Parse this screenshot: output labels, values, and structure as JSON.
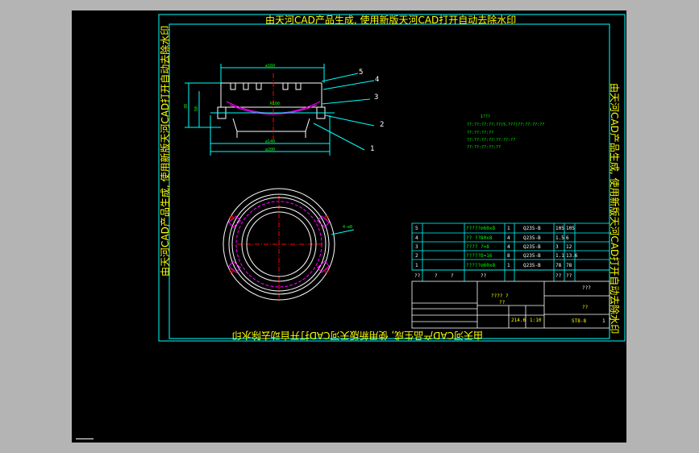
{
  "watermark": "由天河CAD产品生成, 使用新版天河CAD打开自动去除水印",
  "balloons": [
    "5",
    "4",
    "3",
    "2",
    "1"
  ],
  "tech_notes": [
    "1???",
    "??:??:??:??:??(5.???)??:??:??:??",
    "??:??:??:??",
    "??:??:??:??:??:??:??",
    "??:??:??:??:??"
  ],
  "dims": {
    "top": "∅160",
    "bottom": "∅200",
    "inner": "∅140",
    "height": "30",
    "left1": "50",
    "note": "4-∅8",
    "inner_label": "R100"
  },
  "parts": [
    {
      "no": "5",
      "name": "?????∅60x8",
      "qty": "1",
      "mat": "Q235-B",
      "w1": "105",
      "w2": "105"
    },
    {
      "no": "4",
      "name": "?? ??80x8",
      "qty": "4",
      "mat": "Q235-B",
      "w1": "1.5",
      "w2": "6"
    },
    {
      "no": "3",
      "name": "???? ?=8",
      "qty": "4",
      "mat": "Q235-B",
      "w1": "3",
      "w2": "12"
    },
    {
      "no": "2",
      "name": "?????δ=16",
      "qty": "8",
      "mat": "Q235-B",
      "w1": "1.1",
      "w2": "13.6"
    },
    {
      "no": "1",
      "name": "?????∅60x8",
      "qty": "1",
      "mat": "Q235-B",
      "w1": "78",
      "w2": "78"
    }
  ],
  "parts_header": [
    "??",
    "?",
    "?",
    "??",
    "??",
    "??"
  ],
  "title_block": {
    "name1": "???? ?",
    "name2": "??",
    "drawing_no": "??",
    "scale": "214.6",
    "sheet": "1:10",
    "code": "ST8-8",
    "company": "???",
    "page": "1"
  }
}
